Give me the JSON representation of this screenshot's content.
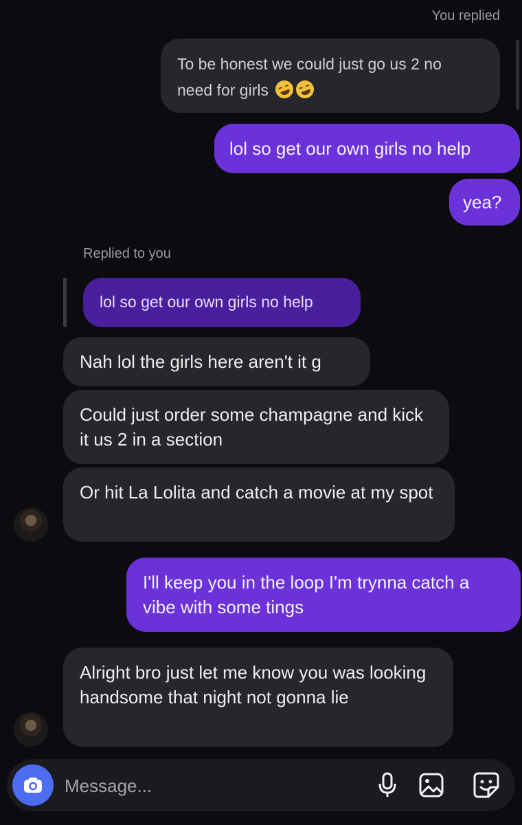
{
  "thread": {
    "you_replied_label": "You replied",
    "quoted_message": {
      "line1": "To be honest we could just go us 2 no",
      "line2": "need for girls"
    },
    "my_messages_1": [
      "lol so get our own girls no help",
      "yea?"
    ],
    "replied_to_you_label": "Replied to you",
    "reply_preview": "lol so get our own girls no help",
    "their_messages_1": [
      "Nah lol the girls here aren't it g",
      "Could just order some champagne and kick it us 2 in a section",
      "Or hit La Lolita and catch a movie at my spot"
    ],
    "my_message_2": "I'll keep you in the loop I'm trynna catch a vibe with some tings",
    "their_message_2": "Alright bro just let me know you was looking handsome that night not gonna lie"
  },
  "composer": {
    "placeholder": "Message...",
    "camera_icon": "camera-icon",
    "mic_icon": "microphone-icon",
    "gallery_icon": "image-icon",
    "sticker_icon": "sticker-icon"
  },
  "colors": {
    "background": "#0b0b10",
    "their_bubble": "#26262c",
    "my_bubble": "#6a32d8",
    "reply_preview": "#4a1f9e",
    "camera_button": "#4c6cf2"
  }
}
